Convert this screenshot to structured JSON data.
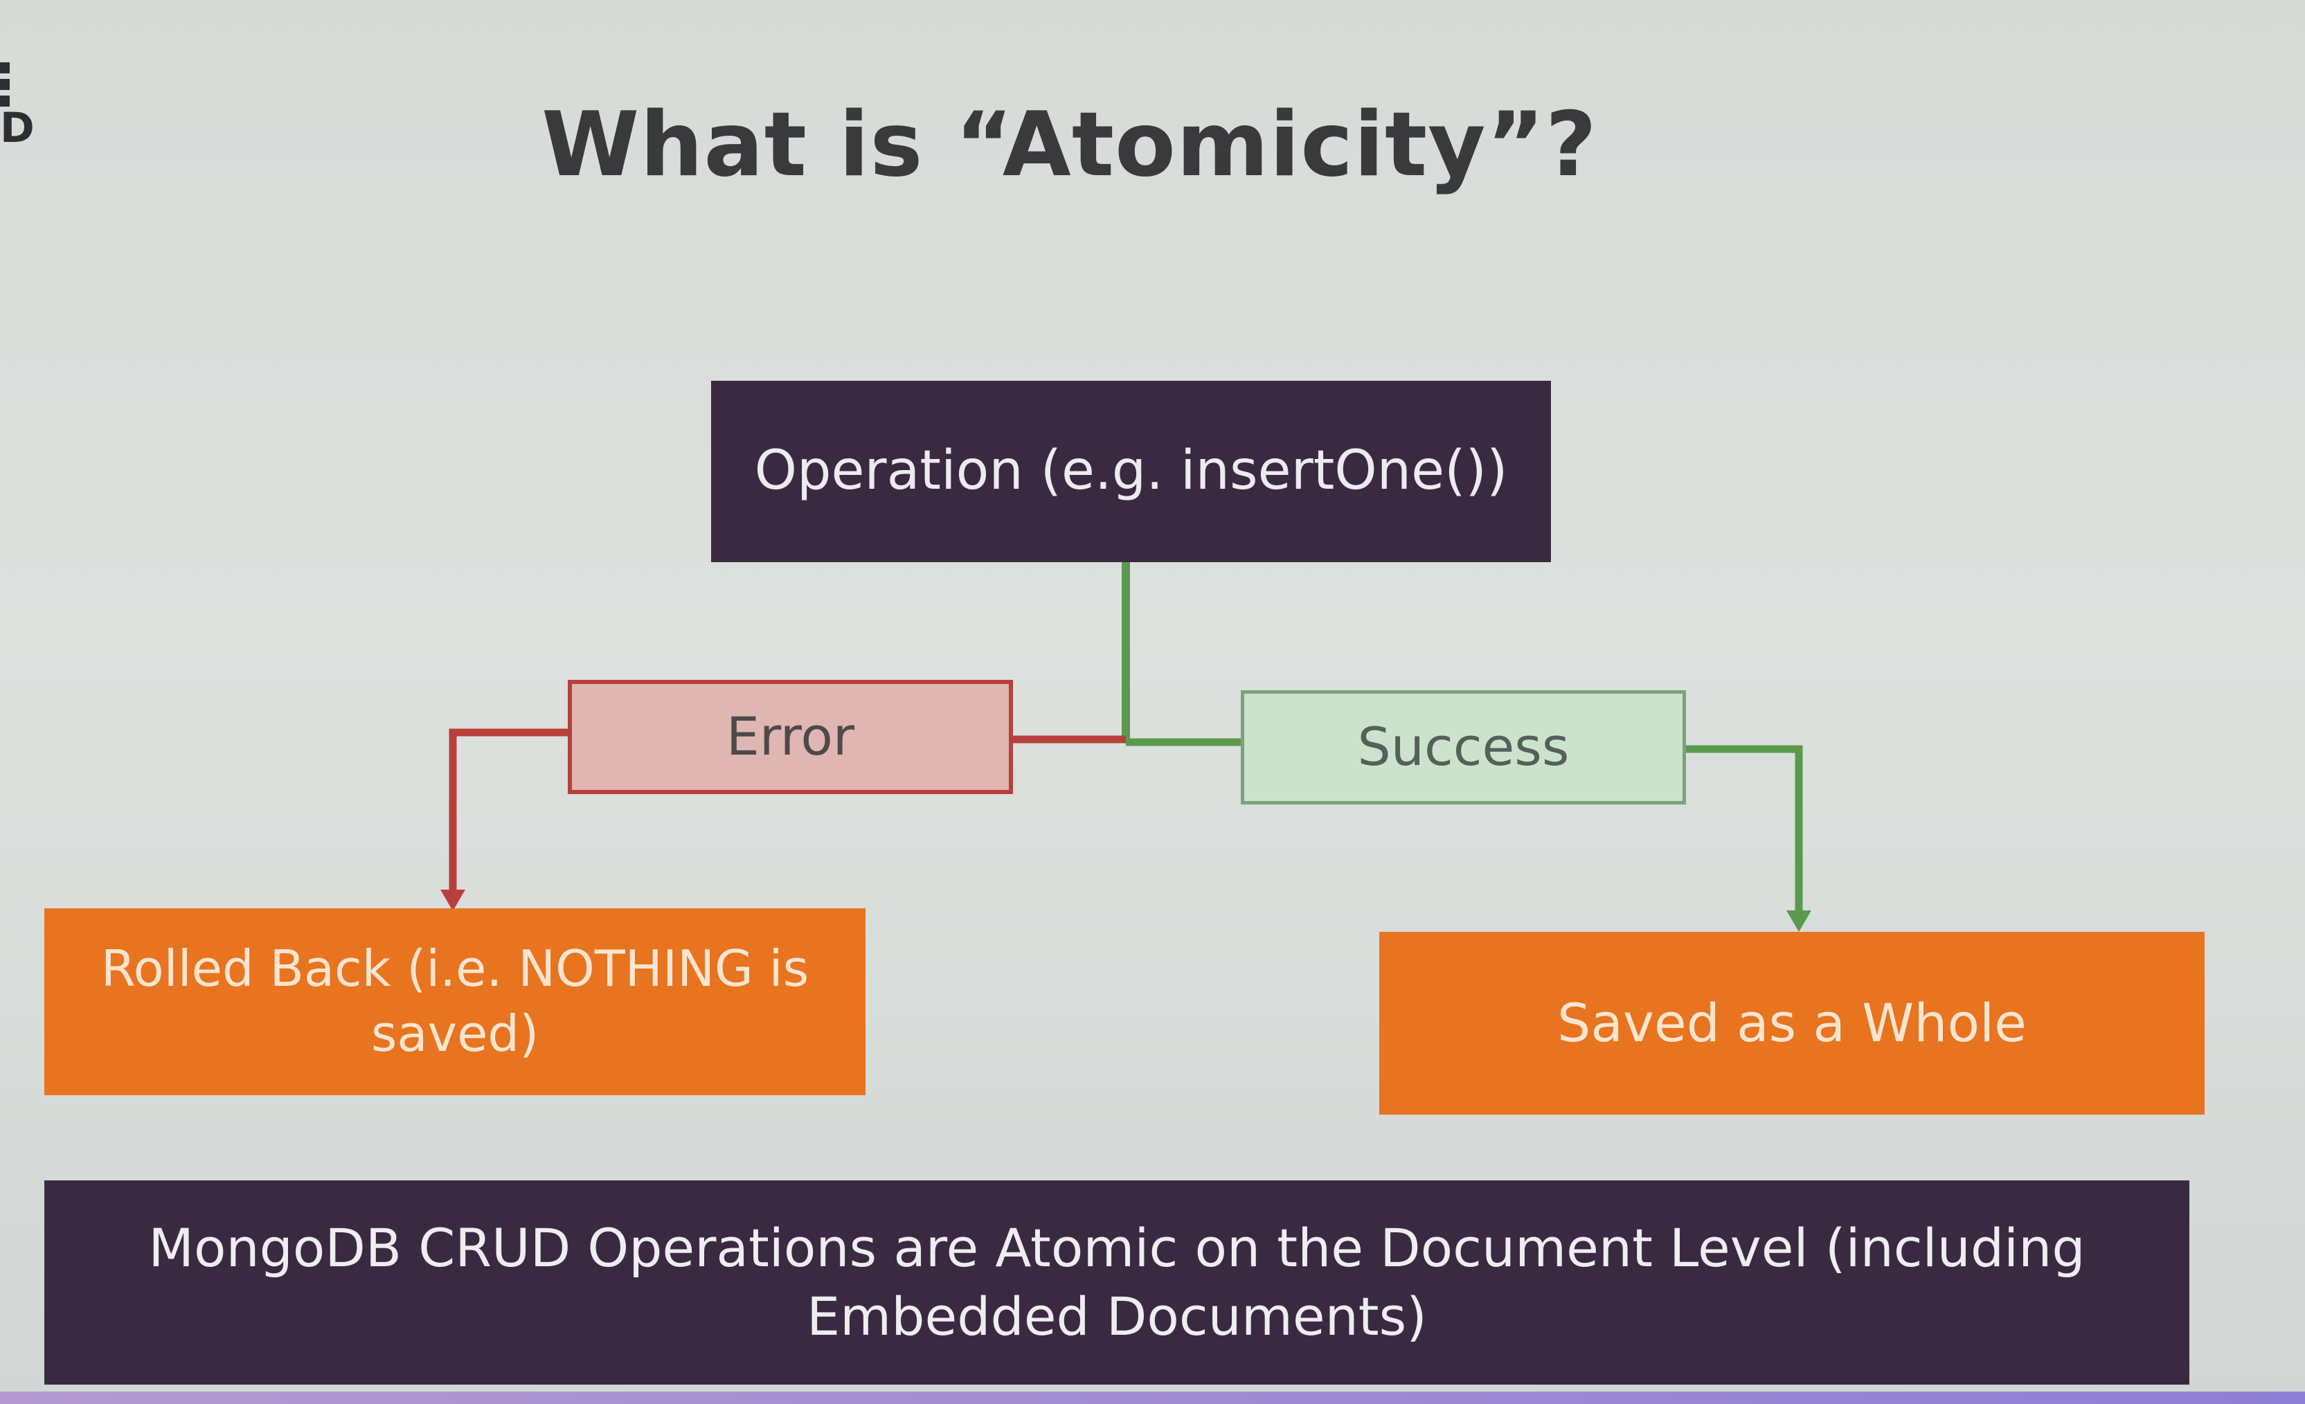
{
  "corner": {
    "letter": "D"
  },
  "slide": {
    "title": "What is “Atomicity”?"
  },
  "diagram": {
    "operation": "Operation (e.g. insertOne())",
    "error": "Error",
    "success": "Success",
    "rolled_back": "Rolled Back (i.e. NOTHING is saved)",
    "saved": "Saved as a Whole"
  },
  "banner": {
    "text": "MongoDB CRUD Operations are Atomic on the Document Level (including Embedded Documents)"
  },
  "colors": {
    "operation_fill": "#3a2a41",
    "error_fill": "#dfb6b2",
    "error_stroke": "#b8403b",
    "success_fill": "#cbe3cd",
    "success_stroke": "#7aa37a",
    "result_fill": "#e8741f",
    "connector_green": "#5a9a4c",
    "connector_red": "#b8403b"
  }
}
